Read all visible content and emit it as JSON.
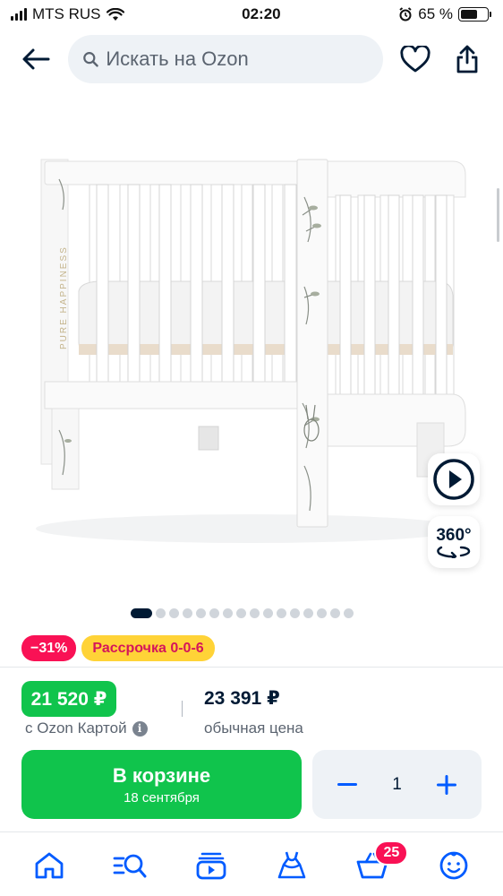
{
  "status_bar": {
    "carrier": "MTS RUS",
    "time": "02:20",
    "battery": "65 %",
    "battery_level": 0.65
  },
  "top_nav": {
    "search_placeholder": "Искать на Ozon"
  },
  "gallery": {
    "image_text": "PURE HAPPINESS",
    "rotate_label": "360°",
    "page_count": 16,
    "active_page": 1
  },
  "badges": {
    "discount": "−31%",
    "installment": "Рассрочка 0-0-6"
  },
  "price": {
    "card_price": "21 520 ₽",
    "card_label": "с Ozon Картой",
    "regular_price": "23 391 ₽",
    "regular_label": "обычная цена"
  },
  "cart": {
    "button_label": "В корзине",
    "delivery_date": "18 сентября",
    "quantity": "1"
  },
  "tab_bar": {
    "cart_count": "25",
    "items": [
      "home-icon",
      "catalog-search-icon",
      "video-icon",
      "dress-icon",
      "cart-icon",
      "profile-icon"
    ]
  },
  "colors": {
    "accent_green": "#10c44c",
    "discount_red": "#f91155",
    "installment_yellow": "#ffd337",
    "brand_blue": "#005bff",
    "text_dark": "#001a34"
  }
}
